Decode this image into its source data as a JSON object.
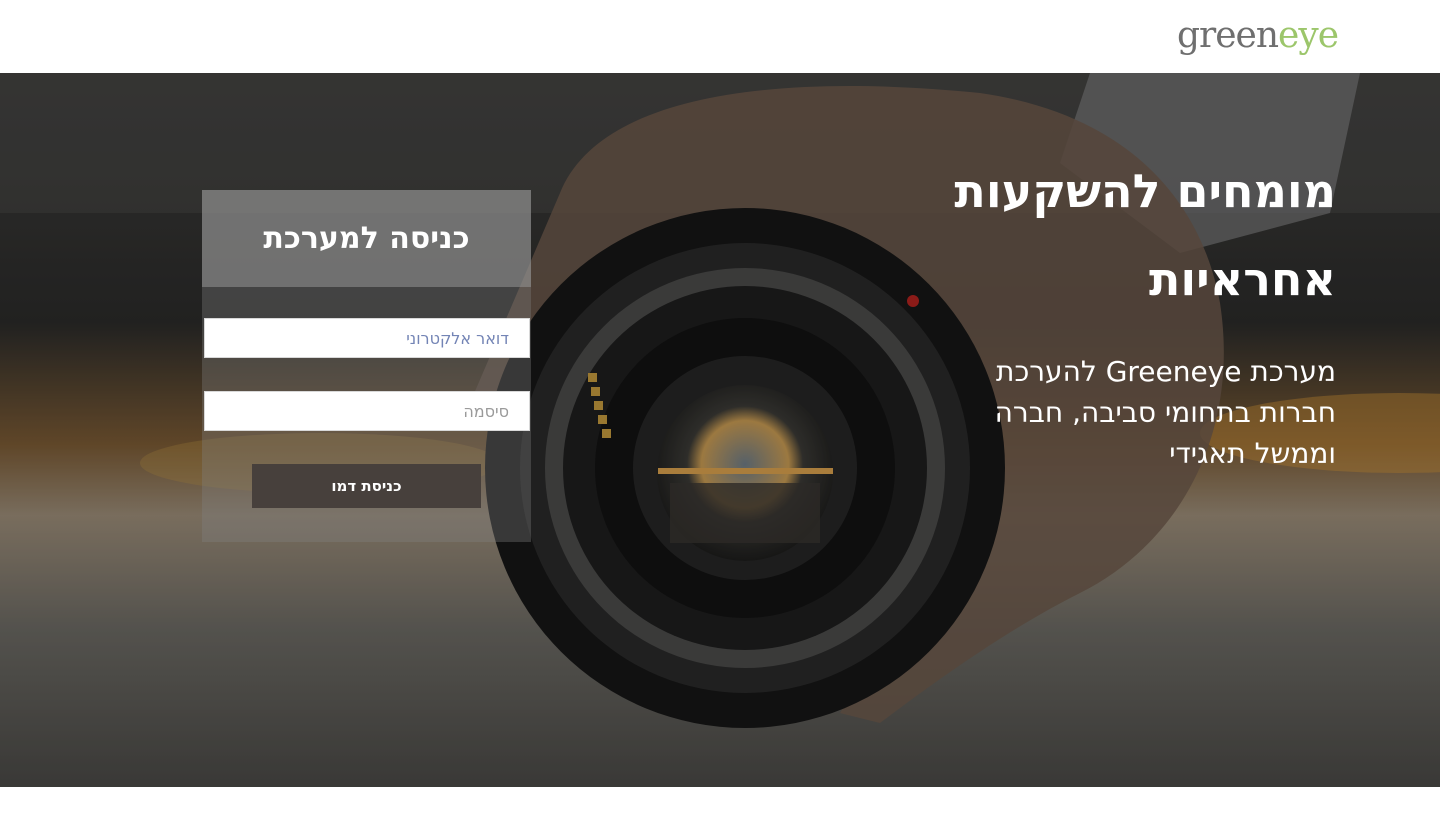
{
  "header": {
    "logo_part1": "green",
    "logo_part2": "eye"
  },
  "hero": {
    "headline_line1": "מומחים להשקעות",
    "headline_line2": "אחראיות",
    "subtext_line1": "מערכת Greeneye להערכת",
    "subtext_line2": "חברות בתחומי סביבה, חברה",
    "subtext_line3": "וממשל תאגידי"
  },
  "login": {
    "title": "כניסה למערכת",
    "email_placeholder": "דואר אלקטרוני",
    "password_placeholder": "סיסמה",
    "demo_button": "כניסת דמו"
  },
  "colors": {
    "logo_grey": "#6f6f6f",
    "logo_green": "#9cc66b",
    "button_bg": "#47403c"
  },
  "icons": {
    "hero_image": "camera-lens-photo"
  }
}
